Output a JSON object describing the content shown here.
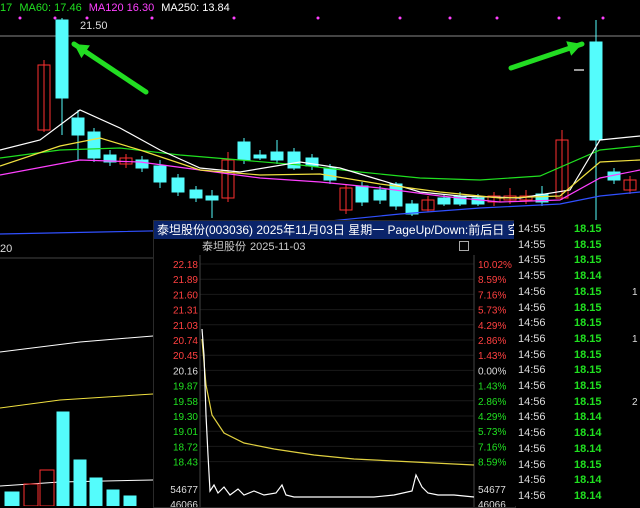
{
  "main_chart": {
    "ma_labels": [
      {
        "text": "17",
        "color": "#20e020"
      },
      {
        "text": "MA60: 17.46",
        "color": "#20e020"
      },
      {
        "text": "MA120 16.30",
        "color": "#ff40ff"
      },
      {
        "text": "MA250: 13.84",
        "color": "#ffffff"
      }
    ],
    "high_label": "21.50",
    "low_label": "20",
    "colors": {
      "up": "#ff3030",
      "down": "#54fcfc",
      "arrow": "#22dd22"
    }
  },
  "popup": {
    "title": "泰坦股份(003036) 2025年11月03日 星期一 PageUp/Down:前后日 空格键:操作",
    "stock_name": "泰坦股份",
    "date": "2025-11-03",
    "price_axis": [
      "22.18",
      "21.89",
      "21.60",
      "21.31",
      "21.03",
      "20.74",
      "20.45",
      "20.16",
      "19.87",
      "19.58",
      "19.30",
      "19.01",
      "18.72",
      "18.43"
    ],
    "pct_axis": [
      "10.02%",
      "8.59%",
      "7.16%",
      "5.73%",
      "4.29%",
      "2.86%",
      "1.43%",
      "0.00%",
      "1.43%",
      "2.86%",
      "4.29%",
      "5.73%",
      "7.16%",
      "8.59%"
    ],
    "volume_labels": [
      "54677",
      "46066"
    ]
  },
  "ticks": [
    {
      "time": "14:55",
      "price": "18.15",
      "mark": ""
    },
    {
      "time": "14:55",
      "price": "18.15",
      "mark": ""
    },
    {
      "time": "14:55",
      "price": "18.15",
      "mark": ""
    },
    {
      "time": "14:55",
      "price": "18.14",
      "mark": ""
    },
    {
      "time": "14:56",
      "price": "18.15",
      "mark": "1"
    },
    {
      "time": "14:56",
      "price": "18.15",
      "mark": ""
    },
    {
      "time": "14:56",
      "price": "18.15",
      "mark": ""
    },
    {
      "time": "14:56",
      "price": "18.15",
      "mark": "1"
    },
    {
      "time": "14:56",
      "price": "18.15",
      "mark": ""
    },
    {
      "time": "14:56",
      "price": "18.15",
      "mark": ""
    },
    {
      "time": "14:56",
      "price": "18.15",
      "mark": ""
    },
    {
      "time": "14:56",
      "price": "18.15",
      "mark": "2"
    },
    {
      "time": "14:56",
      "price": "18.14",
      "mark": ""
    },
    {
      "time": "14:56",
      "price": "18.14",
      "mark": ""
    },
    {
      "time": "14:56",
      "price": "18.14",
      "mark": ""
    },
    {
      "time": "14:56",
      "price": "18.15",
      "mark": ""
    },
    {
      "time": "14:56",
      "price": "18.14",
      "mark": ""
    },
    {
      "time": "14:56",
      "price": "18.14",
      "mark": ""
    }
  ]
}
